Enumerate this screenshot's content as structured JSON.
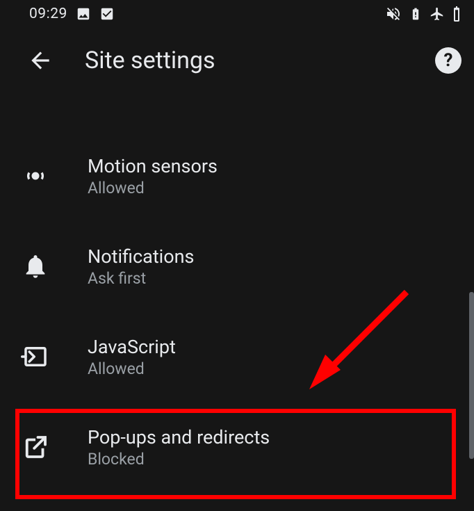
{
  "status": {
    "time": "09:29"
  },
  "header": {
    "title": "Site settings"
  },
  "settings": [
    {
      "id": "motion-sensors",
      "title": "Motion sensors",
      "subtitle": "Allowed"
    },
    {
      "id": "notifications",
      "title": "Notifications",
      "subtitle": "Ask first"
    },
    {
      "id": "javascript",
      "title": "JavaScript",
      "subtitle": "Allowed"
    },
    {
      "id": "popups",
      "title": "Pop-ups and redirects",
      "subtitle": "Blocked"
    }
  ]
}
